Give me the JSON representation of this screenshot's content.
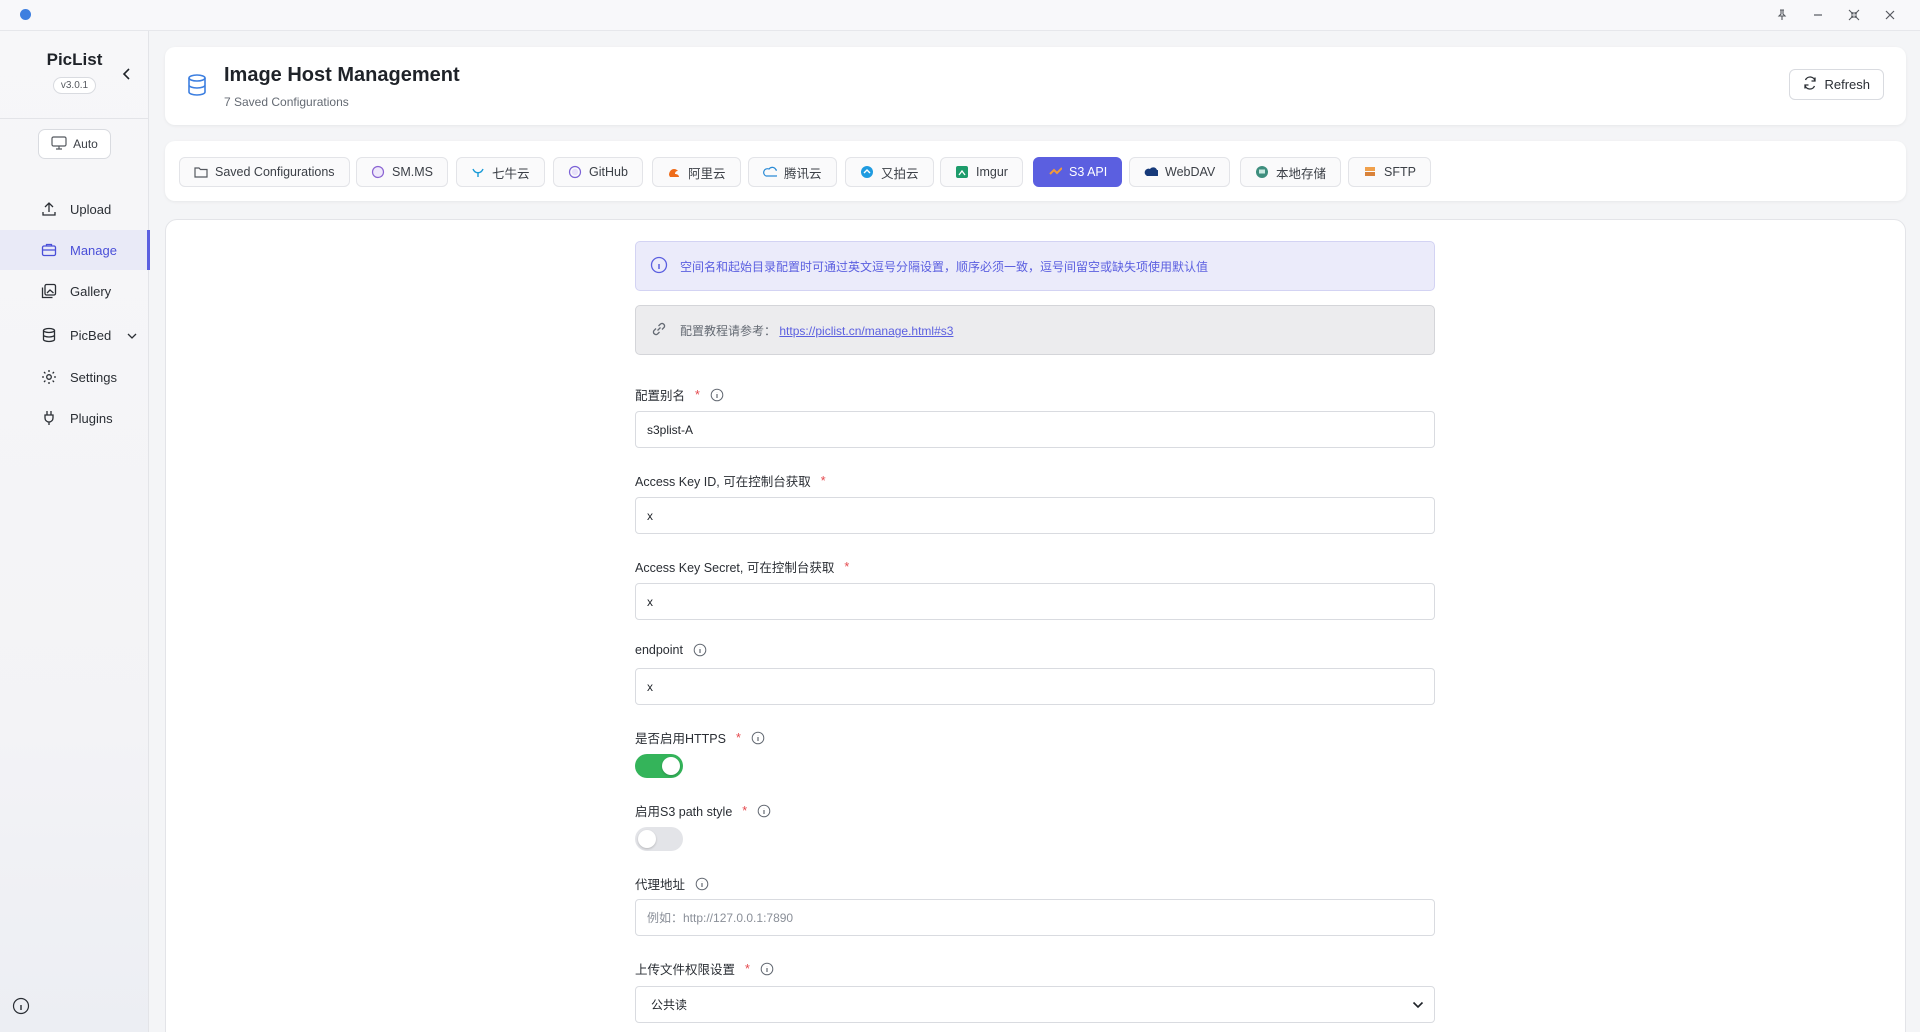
{
  "sidebar": {
    "app_name": "PicList",
    "version": "v3.0.1",
    "auto_label": "Auto",
    "items": [
      {
        "label": "Upload"
      },
      {
        "label": "Manage"
      },
      {
        "label": "Gallery"
      },
      {
        "label": "PicBed"
      },
      {
        "label": "Settings"
      },
      {
        "label": "Plugins"
      }
    ]
  },
  "header": {
    "title": "Image Host Management",
    "subtitle": "7 Saved Configurations",
    "refresh_label": "Refresh"
  },
  "tabs": [
    {
      "label": "Saved Configurations"
    },
    {
      "label": "SM.MS"
    },
    {
      "label": "七牛云"
    },
    {
      "label": "GitHub"
    },
    {
      "label": "阿里云"
    },
    {
      "label": "腾讯云"
    },
    {
      "label": "又拍云"
    },
    {
      "label": "Imgur"
    },
    {
      "label": "S3 API"
    },
    {
      "label": "WebDAV"
    },
    {
      "label": "本地存储"
    },
    {
      "label": "SFTP"
    }
  ],
  "active_tab": "S3 API",
  "notices": {
    "info": "空间名和起始目录配置时可通过英文逗号分隔设置，顺序必须一致，逗号间留空或缺失项使用默认值",
    "link_prefix": "配置教程请参考：",
    "link_text": "https://piclist.cn/manage.html#s3"
  },
  "form": {
    "alias": {
      "label": "配置别名",
      "value": "s3plist-A"
    },
    "access_key_id": {
      "label": "Access Key ID, 可在控制台获取",
      "value": "x"
    },
    "access_key_secret": {
      "label": "Access Key Secret, 可在控制台获取",
      "value": "x"
    },
    "endpoint": {
      "label": "endpoint",
      "value": "x"
    },
    "https": {
      "label": "是否启用HTTPS",
      "enabled": true
    },
    "path_style": {
      "label": "启用S3 path style",
      "enabled": false
    },
    "proxy": {
      "label": "代理地址",
      "value": "",
      "placeholder": "例如：http://127.0.0.1:7890"
    },
    "acl": {
      "label": "上传文件权限设置",
      "value": "公共读"
    }
  },
  "colors": {
    "accent": "#5b5fe0",
    "toggle_on": "#34b45a",
    "required": "#e5484d"
  }
}
